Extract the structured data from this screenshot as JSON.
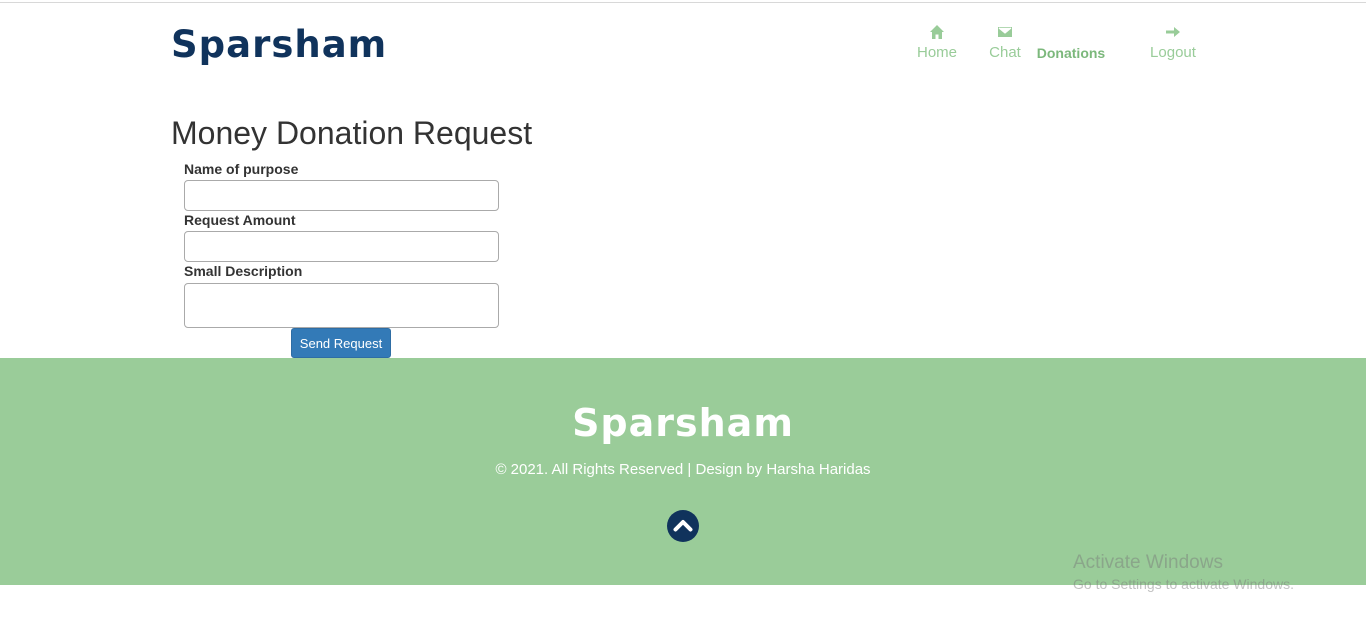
{
  "header": {
    "logo": "Sparsham",
    "nav": {
      "home": {
        "label": "Home",
        "icon": "home-icon"
      },
      "chat": {
        "label": "Chat",
        "icon": "envelope-icon"
      },
      "donations": {
        "label": "Donations"
      },
      "logout": {
        "label": "Logout",
        "icon": "arrow-right-icon"
      }
    }
  },
  "main": {
    "title": "Money Donation Request",
    "form": {
      "purpose_label": "Name of purpose",
      "purpose_value": "",
      "amount_label": "Request Amount",
      "amount_value": "",
      "description_label": "Small Description",
      "description_value": "",
      "submit_label": "Send Request"
    }
  },
  "footer": {
    "logo": "Sparsham",
    "copyright": "© 2021. All Rights Reserved | Design by Harsha Haridas",
    "scroll_top_icon": "chevron-up-icon"
  },
  "watermark": {
    "line1": "Activate Windows",
    "line2": "Go to Settings to activate Windows."
  },
  "colors": {
    "brand_navy": "#10335c",
    "accent_green": "#9acc99",
    "nav_green": "#99cc99",
    "button_blue": "#337ab7"
  }
}
